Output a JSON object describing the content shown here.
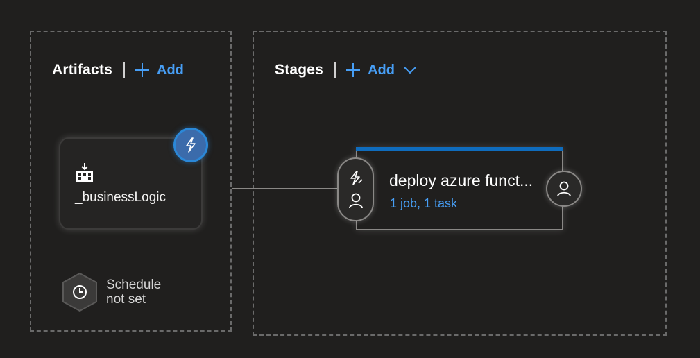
{
  "artifacts": {
    "title": "Artifacts",
    "add_label": "Add",
    "card": {
      "name": "_businessLogic"
    },
    "schedule": {
      "line1": "Schedule",
      "line2": "not set"
    }
  },
  "stages": {
    "title": "Stages",
    "add_label": "Add",
    "stage": {
      "name": "deploy azure funct...",
      "tasks": "1 job, 1 task"
    }
  },
  "icons": {
    "add": "plus-icon",
    "dropdown": "chevron-down-icon",
    "trigger": "lightning-icon",
    "build": "build-artifact-icon",
    "schedule": "clock-icon",
    "approver": "person-icon"
  },
  "colors": {
    "accent": "#479ef5",
    "trigger_badge": "#3b6bab",
    "stage_bar": "#0f6cbd"
  }
}
